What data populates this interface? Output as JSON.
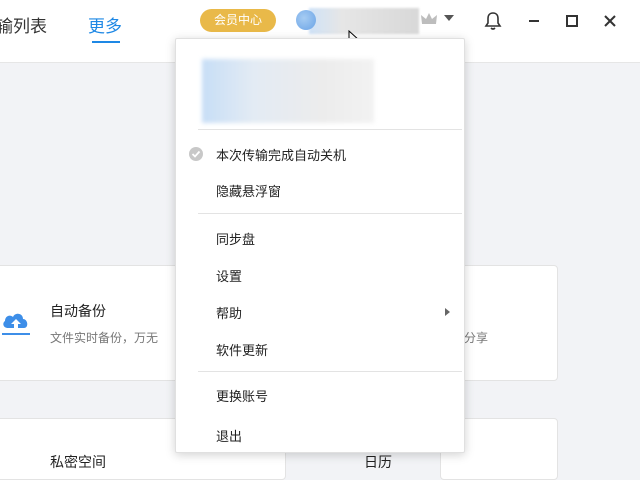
{
  "header": {
    "tabs": [
      {
        "label": "输列表",
        "active": false
      },
      {
        "label": "更多",
        "active": true
      }
    ],
    "vip_label": "会员中心",
    "window_controls": [
      "bell-icon",
      "minimize-icon",
      "maximize-icon",
      "close-icon"
    ]
  },
  "colors": {
    "accent": "#1e88e5",
    "vip": "#e9b949"
  },
  "background": {
    "card1": {
      "title": "自动备份",
      "desc": "文件实时备份，万无"
    },
    "card2": {
      "desc": "分享"
    },
    "bottom_left": "私密空间",
    "bottom_right": "日历"
  },
  "menu": {
    "items": [
      {
        "label": "本次传输完成自动关机",
        "checked": true
      },
      {
        "label": "隐藏悬浮窗"
      },
      {
        "label": "同步盘"
      },
      {
        "label": "设置"
      },
      {
        "label": "帮助",
        "submenu": true
      },
      {
        "label": "软件更新"
      },
      {
        "label": "更换账号"
      },
      {
        "label": "退出"
      }
    ]
  }
}
